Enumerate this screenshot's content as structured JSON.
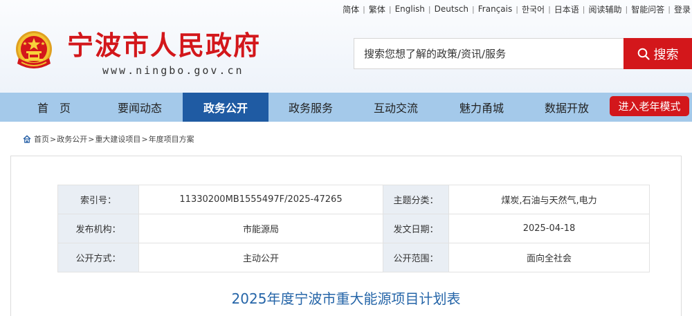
{
  "header": {
    "top_links": [
      "简体",
      "繁体",
      "English",
      "Deutsch",
      "Français",
      "한국어",
      "日本语",
      "阅读辅助",
      "智能问答",
      "登录"
    ],
    "site_title": "宁波市人民政府",
    "site_domain": "www.ningbo.gov.cn",
    "search": {
      "placeholder": "搜索您想了解的政策/资讯/服务",
      "button_label": "搜索"
    }
  },
  "nav": {
    "items": [
      "首　页",
      "要闻动态",
      "政务公开",
      "政务服务",
      "互动交流",
      "魅力甬城",
      "数据开放"
    ],
    "active_index": 2,
    "elder_mode_label": "进入老年模式"
  },
  "breadcrumb": [
    "首页",
    "政务公开",
    "重大建设项目",
    "年度项目方案"
  ],
  "meta": {
    "index_label": "索引号：",
    "index_value": "11330200MB1555497F/2025-47265",
    "topic_label": "主题分类：",
    "topic_value": "煤炭,石油与天然气,电力",
    "org_label": "发布机构：",
    "org_value": "市能源局",
    "date_label": "发文日期：",
    "date_value": "2025-04-18",
    "method_label": "公开方式：",
    "method_value": "主动公开",
    "scope_label": "公开范围：",
    "scope_value": "面向全社会"
  },
  "document": {
    "title": "2025年度宁波市重大能源项目计划表"
  },
  "colors": {
    "brand_red": "#d3171b",
    "nav_bg": "#a4c9ea",
    "nav_active": "#1f5ba3",
    "title_blue": "#2565a8"
  }
}
